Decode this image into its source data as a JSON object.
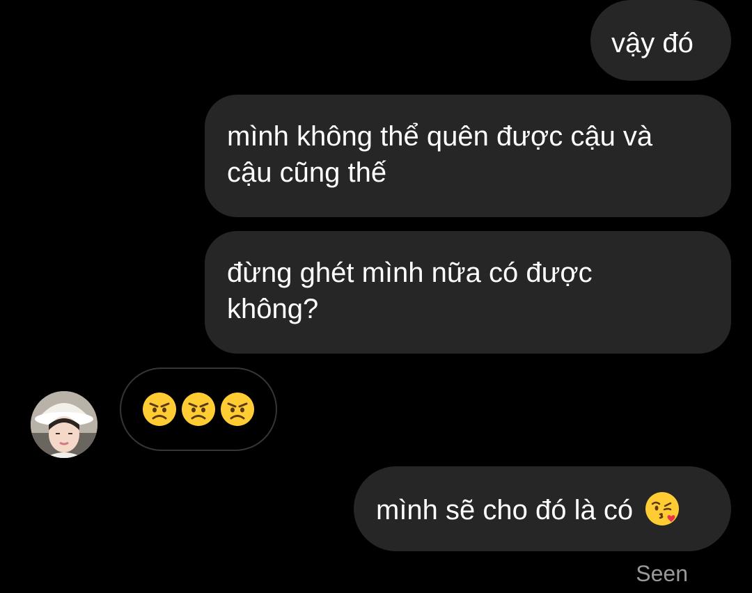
{
  "messages": [
    {
      "sender": "me",
      "text": "vậy đó"
    },
    {
      "sender": "me",
      "lines": [
        "mình không thể quên được cậu và",
        "cậu cũng thế"
      ]
    },
    {
      "sender": "me",
      "lines": [
        "đừng ghét mình nữa có được",
        "không?"
      ]
    },
    {
      "sender": "other",
      "emoji": [
        "angry-face-icon",
        "angry-face-icon",
        "angry-face-icon"
      ]
    },
    {
      "sender": "me",
      "text": "mình sẽ cho đó là có",
      "emoji": "face-blowing-kiss-icon"
    }
  ],
  "status": {
    "seen_label": "Seen"
  },
  "colors": {
    "background": "#000000",
    "bubble": "#262626",
    "emoji_bubble_border": "#363636",
    "seen_text": "#9a9a9a"
  }
}
